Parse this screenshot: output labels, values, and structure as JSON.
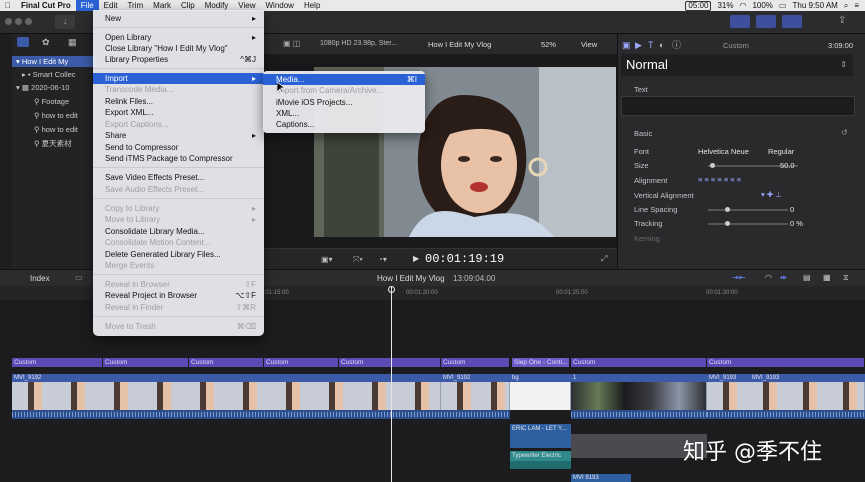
{
  "menubar": {
    "app": "Final Cut Pro",
    "items": [
      "File",
      "Edit",
      "Trim",
      "Mark",
      "Clip",
      "Modify",
      "View",
      "Window",
      "Help"
    ],
    "clock": "Thu 9:50 AM",
    "timer": "05:00",
    "battery": "100%",
    "stat_cpu": "31%"
  },
  "file_menu": {
    "items": [
      {
        "label": "New",
        "shortcut": "▸"
      },
      {
        "label": "Open Library",
        "shortcut": "▸"
      },
      {
        "label": "Close Library \"How I Edit My Vlog\"",
        "shortcut": ""
      },
      {
        "label": "Library Properties",
        "shortcut": "^⌘J"
      },
      {
        "label": "Import",
        "shortcut": "▸"
      },
      {
        "label": "Transcode Media...",
        "shortcut": ""
      },
      {
        "label": "Relink Files...",
        "shortcut": ""
      },
      {
        "label": "Export XML...",
        "shortcut": ""
      },
      {
        "label": "Export Captions...",
        "shortcut": ""
      },
      {
        "label": "Share",
        "shortcut": "▸"
      },
      {
        "label": "Send to Compressor",
        "shortcut": ""
      },
      {
        "label": "Send iTMS Package to Compressor",
        "shortcut": ""
      },
      {
        "label": "Save Video Effects Preset...",
        "shortcut": ""
      },
      {
        "label": "Save Audio Effects Preset...",
        "shortcut": ""
      },
      {
        "label": "Copy to Library",
        "shortcut": "▸"
      },
      {
        "label": "Move to Library",
        "shortcut": "▸"
      },
      {
        "label": "Consolidate Library Media...",
        "shortcut": ""
      },
      {
        "label": "Consolidate Motion Content...",
        "shortcut": ""
      },
      {
        "label": "Delete Generated Library Files...",
        "shortcut": ""
      },
      {
        "label": "Merge Events",
        "shortcut": ""
      },
      {
        "label": "Reveal in Browser",
        "shortcut": "⇧F"
      },
      {
        "label": "Reveal Project in Browser",
        "shortcut": "⌥⇧F"
      },
      {
        "label": "Reveal in Finder",
        "shortcut": "⇧⌘R"
      },
      {
        "label": "Move to Trash",
        "shortcut": "⌘⌫"
      }
    ]
  },
  "import_submenu": {
    "items": [
      {
        "label": "Media...",
        "shortcut": "⌘I"
      },
      {
        "label": "Import from Camera/Archive...",
        "shortcut": ""
      },
      {
        "label": "iMovie iOS Projects...",
        "shortcut": ""
      },
      {
        "label": "XML...",
        "shortcut": ""
      },
      {
        "label": "Captions...",
        "shortcut": ""
      }
    ]
  },
  "sidebar": {
    "items": [
      {
        "label": "How I Edit My"
      },
      {
        "label": "Smart Collec"
      },
      {
        "label": "2020-06-10"
      },
      {
        "label": "Footage"
      },
      {
        "label": "how to edit"
      },
      {
        "label": "how to edit"
      },
      {
        "label": "夏天素材"
      }
    ]
  },
  "viewer": {
    "format": "1080p HD 23.98p, Ster...",
    "title": "How I Edit My Vlog",
    "zoom": "52%",
    "view": "View",
    "timecode": "00:01:19:19"
  },
  "inspector": {
    "title_tab": "Custom",
    "duration": "3:09:00",
    "preset": "Normal",
    "section_text": "Text",
    "section_basic": "Basic",
    "rows": [
      {
        "label": "Font",
        "value": "Helvetica Neue",
        "value2": "Regular"
      },
      {
        "label": "Size",
        "value": "50.0"
      },
      {
        "label": "Alignment",
        "value": ""
      },
      {
        "label": "Vertical Alignment",
        "value": ""
      },
      {
        "label": "Line Spacing",
        "value": "0"
      },
      {
        "label": "Tracking",
        "value": "0 %"
      },
      {
        "label": "Kerning",
        "value": ""
      }
    ]
  },
  "timeline": {
    "index_label": "Index",
    "project": "How I Edit My Vlog",
    "duration": "13:09:04.00",
    "ruler": [
      "00:01:15:00",
      "00:01:20:00",
      "00:01:25:00",
      "00:01:30:00"
    ],
    "title_clips": [
      "Custom",
      "Custom",
      "Custom",
      "Custom",
      "Custom",
      "Custom",
      "Slep One - Conti...",
      "Custom",
      "Custom"
    ],
    "video_clips": [
      "MVI_9192",
      "MVI_9192",
      "bg",
      "1",
      "MVI_9193",
      "MVI_9193"
    ],
    "audio_clips": [
      "ERIC LAM - LET Y...",
      "Typewriter Electric",
      "MVI 9193"
    ]
  },
  "watermark": "知乎 @季不住"
}
